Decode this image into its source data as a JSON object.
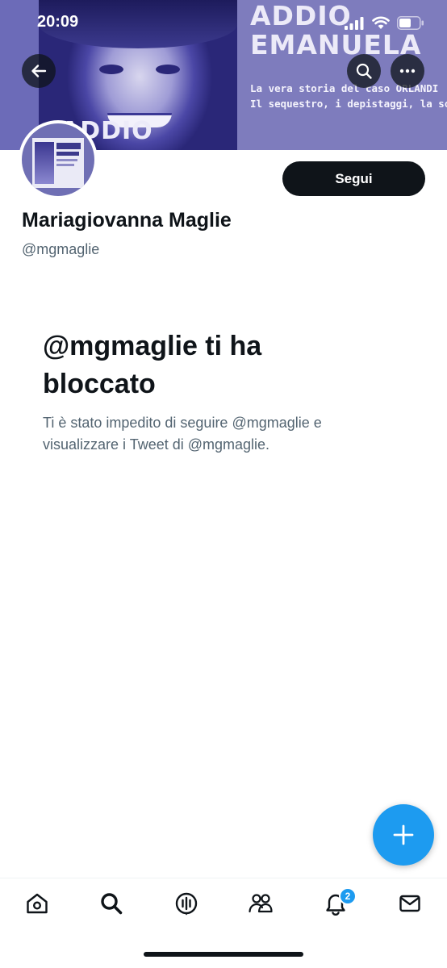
{
  "status_bar": {
    "time": "20:09"
  },
  "banner": {
    "title_line1": "ADDIO",
    "title_line2": "EMANUELA",
    "subtitle_line1": "La vera storia del caso ORLANDI",
    "subtitle_line2": "Il sequestro, i depistaggi, la soluzione",
    "lower_title": "ADDIO"
  },
  "profile": {
    "display_name": "Mariagiovanna Maglie",
    "handle": "@mgmaglie",
    "follow_label": "Segui"
  },
  "blocked": {
    "title": "@mgmaglie ti ha bloccato",
    "description": "Ti è stato impedito di seguire @mgmaglie e visualizzare i Tweet di @mgmaglie."
  },
  "nav": {
    "notifications_badge": "2"
  },
  "colors": {
    "accent": "#1d9bf0",
    "text_primary": "#0f1419",
    "text_secondary": "#536471"
  },
  "icons": {
    "back": "arrow-left-icon",
    "search": "search-icon",
    "more": "more-horizontal-icon",
    "compose": "plus-icon",
    "home": "home-icon",
    "explore": "search-icon",
    "spaces": "microphone-icon",
    "communities": "people-icon",
    "notifications": "bell-icon",
    "messages": "envelope-icon"
  }
}
